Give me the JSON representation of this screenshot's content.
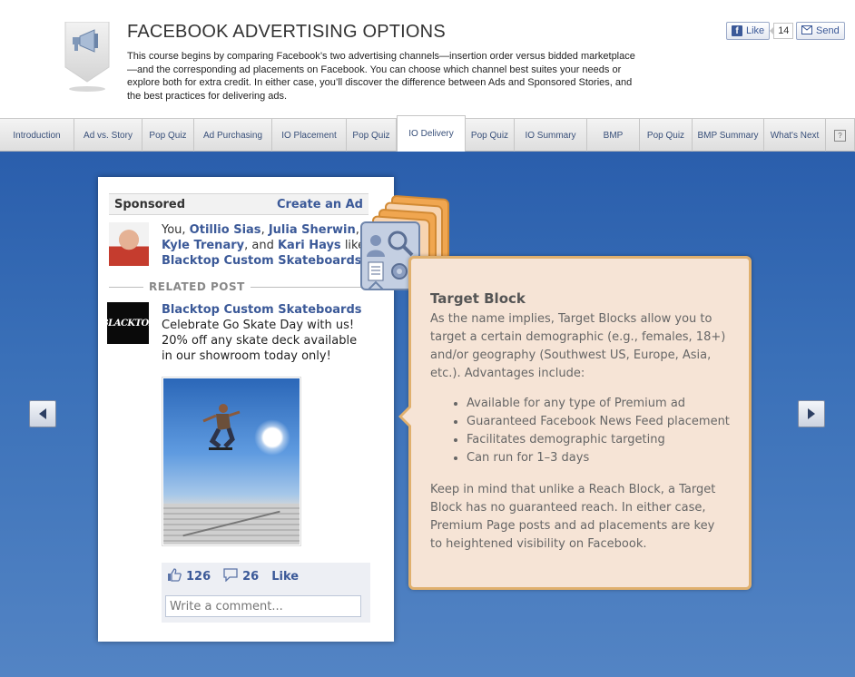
{
  "header": {
    "title": "FACEBOOK ADVERTISING OPTIONS",
    "description": "This course begins by comparing Facebook’s two advertising channels—insertion order versus bidded marketplace—and the corresponding ad placements on Facebook. You can choose which channel best suites your needs or explore both for extra credit. In either case, you’ll discover the difference between Ads and Sponsored Stories, and the best practices for delivering ads.",
    "badge_icon": "megaphone-icon",
    "like_label": "Like",
    "like_count": "14",
    "send_label": "Send"
  },
  "tabs": [
    {
      "label": "Introduction"
    },
    {
      "label": "Ad vs. Story"
    },
    {
      "label": "Pop Quiz"
    },
    {
      "label": "Ad Purchasing"
    },
    {
      "label": "IO Placement"
    },
    {
      "label": "Pop Quiz"
    },
    {
      "label": "IO Delivery",
      "active": true
    },
    {
      "label": "Pop Quiz"
    },
    {
      "label": "IO Summary"
    },
    {
      "label": "BMP"
    },
    {
      "label": "Pop Quiz"
    },
    {
      "label": "BMP Summary"
    },
    {
      "label": "What's Next"
    }
  ],
  "help_label": "?",
  "card": {
    "sponsored": "Sponsored",
    "create_ad": "Create an Ad",
    "social_prefix": "You, ",
    "friend1": "Otillio Sias",
    "sep1": ", ",
    "friend2": "Julia Sherwin",
    "sep2": ", ",
    "friend3": "Kyle Trenary",
    "sep3": ", and ",
    "friend4": "Kari Hays",
    "social_suffix": " like ",
    "page_name": "Blacktop Custom Skateboards",
    "period": ".",
    "related_post": "RELATED POST",
    "logo_text": "BLACKTOP",
    "post_page": "Blacktop Custom Skateboards",
    "post_body": "Celebrate Go Skate Day with us! 20% off any skate deck available in our showroom today only!",
    "like_count": "126",
    "comment_count": "26",
    "like_action": "Like",
    "comment_placeholder": "Write a comment..."
  },
  "panel": {
    "title": "Target Block",
    "intro": "As the name implies, Target Blocks allow you to target a certain demographic (e.g., females, 18+) and/or geography (Southwest US, Europe, Asia, etc.). Advantages include:",
    "bullets": [
      "Available for any type of Premium ad",
      "Guaranteed Facebook News Feed placement",
      "Facilitates demographic targeting",
      "Can run for 1–3 days"
    ],
    "outro": "Keep in mind that unlike a Reach Block, a Target Block has no guaranteed reach. In either case, Premium Page posts and ad placements are key to heightened visibility on Facebook."
  },
  "colors": {
    "fb_blue": "#3b5998",
    "stage_blue": "#2a5eac",
    "panel_bg": "#f6e4d6",
    "panel_border": "#e0b06e"
  }
}
